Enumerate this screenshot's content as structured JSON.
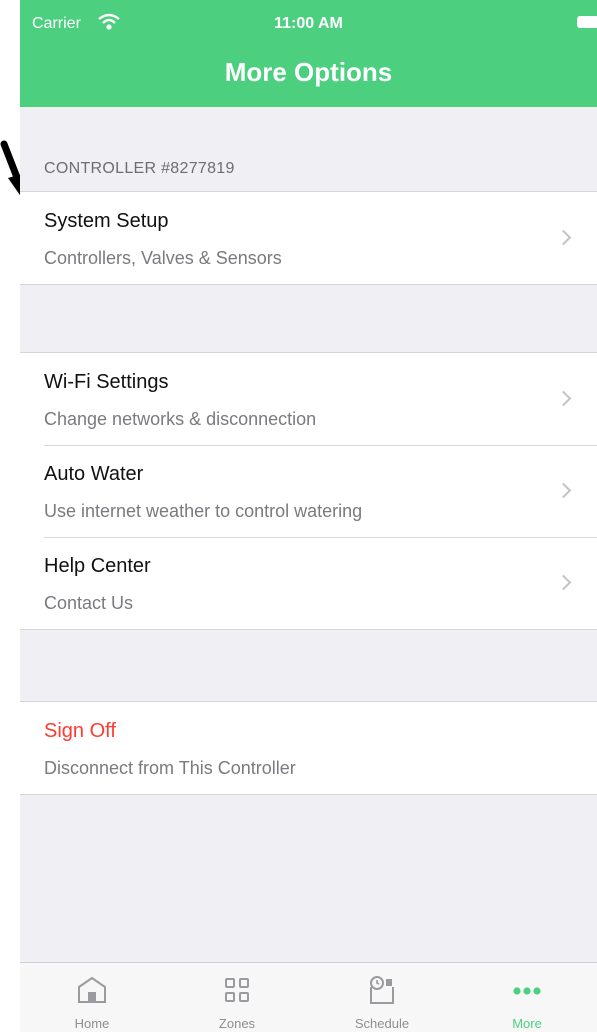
{
  "status": {
    "carrier": "Carrier",
    "time": "11:00 AM"
  },
  "nav": {
    "title": "More Options"
  },
  "section": {
    "header": "CONTROLLER #8277819"
  },
  "rows": [
    {
      "title": "System Setup",
      "subtitle": "Controllers, Valves & Sensors"
    },
    {
      "title": "Wi-Fi Settings",
      "subtitle": "Change networks & disconnection"
    },
    {
      "title": "Auto Water",
      "subtitle": "Use internet weather to control watering"
    },
    {
      "title": "Help Center",
      "subtitle": "Contact Us"
    },
    {
      "title": "Sign Off",
      "subtitle": "Disconnect from This Controller"
    }
  ],
  "tabs": [
    {
      "label": "Home",
      "icon": "home-icon"
    },
    {
      "label": "Zones",
      "icon": "zones-grid-icon"
    },
    {
      "label": "Schedule",
      "icon": "schedule-calendar-icon"
    },
    {
      "label": "More",
      "icon": "more-dots-icon",
      "active": true
    }
  ],
  "colors": {
    "accent": "#4cd080",
    "danger": "#ff3b30",
    "background": "#efeff4"
  }
}
